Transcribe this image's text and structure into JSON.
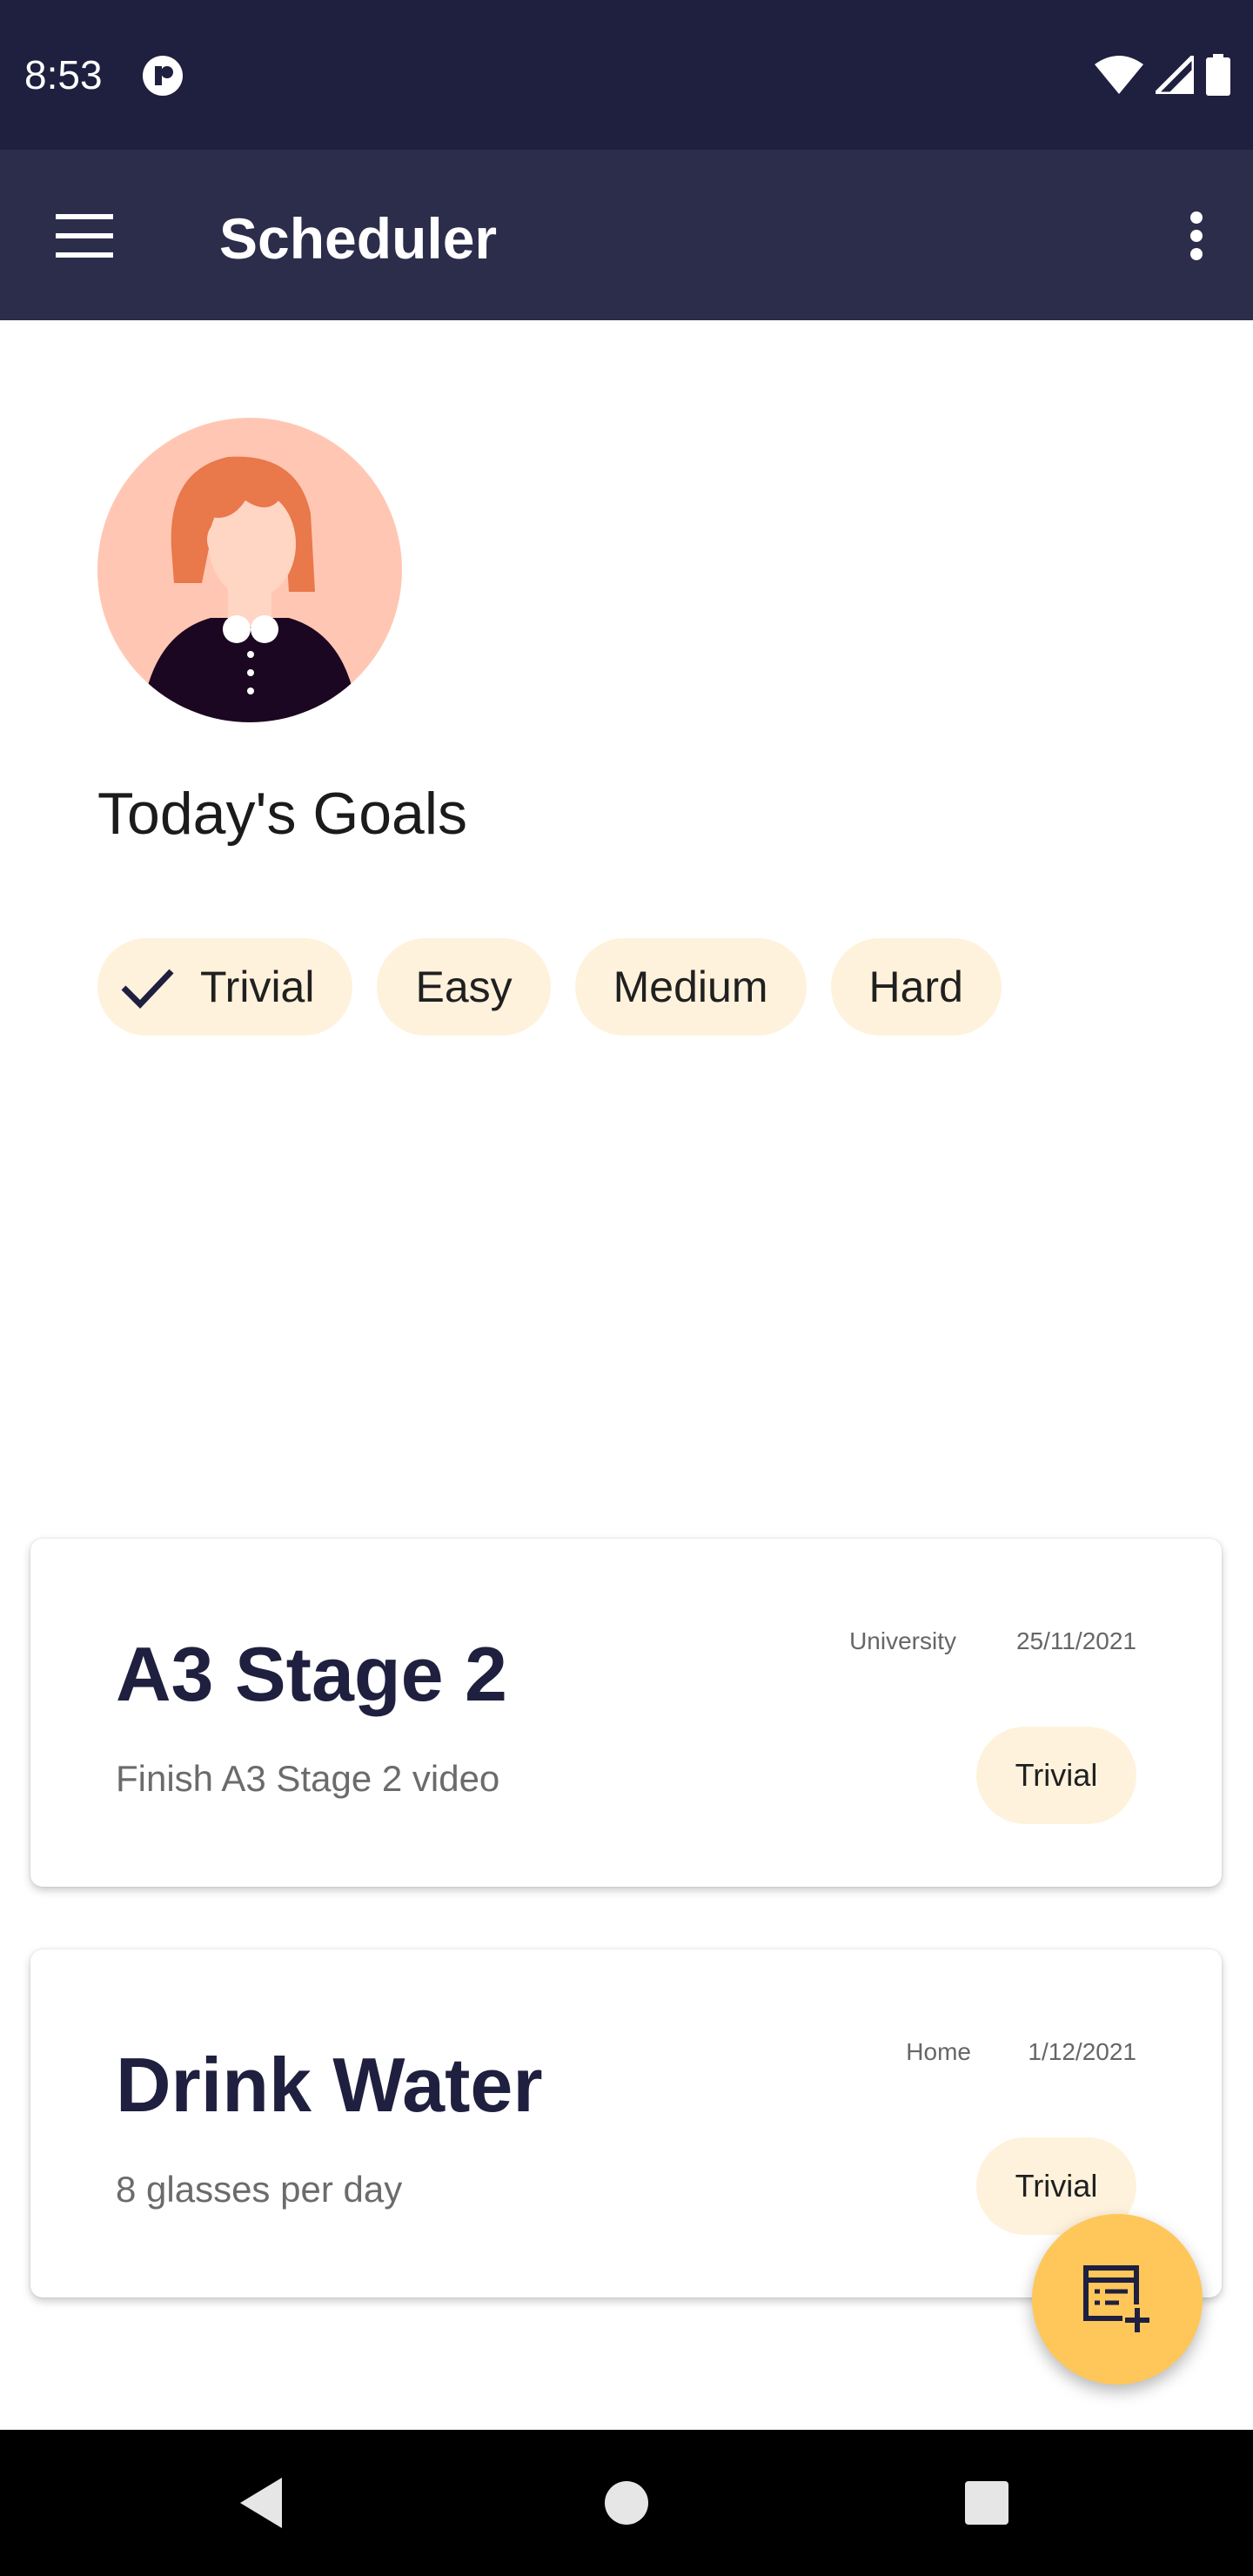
{
  "status_bar": {
    "time": "8:53"
  },
  "app_bar": {
    "title": "Scheduler"
  },
  "goals": {
    "title": "Today's Goals"
  },
  "filters": [
    {
      "label": "Trivial",
      "selected": true
    },
    {
      "label": "Easy",
      "selected": false
    },
    {
      "label": "Medium",
      "selected": false
    },
    {
      "label": "Hard",
      "selected": false
    }
  ],
  "tasks": [
    {
      "title": "A3 Stage 2",
      "description": "Finish A3 Stage 2 video",
      "category": "University",
      "date": "25/11/2021",
      "difficulty": "Trivial"
    },
    {
      "title": "Drink Water",
      "description": "8 glasses per day",
      "category": "Home",
      "date": "1/12/2021",
      "difficulty": "Trivial"
    }
  ],
  "colors": {
    "status_bar": "#1f1f3f",
    "app_bar": "#2c2c4b",
    "chip": "#fff2dc",
    "fab": "#ffc75a",
    "title_text": "#1f1f3f"
  },
  "icons": {
    "menu": "menu-icon",
    "more": "more-vert-icon",
    "check": "check-icon",
    "fab": "add-task-icon",
    "back": "back-icon",
    "home": "home-icon",
    "recents": "recents-icon"
  }
}
